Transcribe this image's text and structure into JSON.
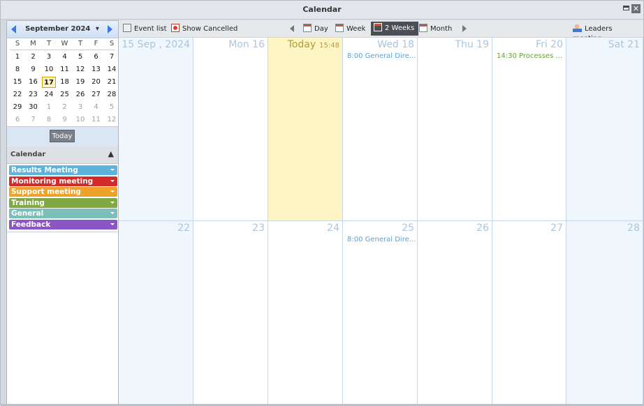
{
  "window": {
    "title": "Calendar",
    "close_glyph": "✕"
  },
  "mini_calendar": {
    "month_label": "September 2024",
    "dropdown_glyph": "▾",
    "weekdays": [
      "S",
      "M",
      "T",
      "W",
      "T",
      "F",
      "S"
    ],
    "weeks": [
      [
        {
          "d": "1"
        },
        {
          "d": "2"
        },
        {
          "d": "3"
        },
        {
          "d": "4"
        },
        {
          "d": "5"
        },
        {
          "d": "6"
        },
        {
          "d": "7"
        }
      ],
      [
        {
          "d": "8"
        },
        {
          "d": "9"
        },
        {
          "d": "10"
        },
        {
          "d": "11"
        },
        {
          "d": "12"
        },
        {
          "d": "13"
        },
        {
          "d": "14"
        }
      ],
      [
        {
          "d": "15"
        },
        {
          "d": "16"
        },
        {
          "d": "17",
          "today": true
        },
        {
          "d": "18"
        },
        {
          "d": "19"
        },
        {
          "d": "20"
        },
        {
          "d": "21"
        }
      ],
      [
        {
          "d": "22"
        },
        {
          "d": "23"
        },
        {
          "d": "24"
        },
        {
          "d": "25"
        },
        {
          "d": "26"
        },
        {
          "d": "27"
        },
        {
          "d": "28"
        }
      ],
      [
        {
          "d": "29"
        },
        {
          "d": "30"
        },
        {
          "d": "1",
          "other": true
        },
        {
          "d": "2",
          "other": true
        },
        {
          "d": "3",
          "other": true
        },
        {
          "d": "4",
          "other": true
        },
        {
          "d": "5",
          "other": true
        }
      ],
      [
        {
          "d": "6",
          "other": true
        },
        {
          "d": "7",
          "other": true
        },
        {
          "d": "8",
          "other": true
        },
        {
          "d": "9",
          "other": true
        },
        {
          "d": "10",
          "other": true
        },
        {
          "d": "11",
          "other": true
        },
        {
          "d": "12",
          "other": true
        }
      ]
    ],
    "today_button": "Today"
  },
  "calendar_panel": {
    "header": "Calendar",
    "collapse_glyph": "⌃",
    "categories": [
      {
        "label": "Results Meeting",
        "color": "#5cb3dc"
      },
      {
        "label": "Monitoring meeting",
        "color": "#d32a2a"
      },
      {
        "label": "Support meeting",
        "color": "#eea22a"
      },
      {
        "label": "Training",
        "color": "#80a843"
      },
      {
        "label": "General",
        "color": "#7ac0b8"
      },
      {
        "label": "Feedback",
        "color": "#8a56c6"
      }
    ]
  },
  "toolbar": {
    "event_list": "Event list",
    "show_cancelled": "Show Cancelled",
    "day": "Day",
    "week": "Week",
    "two_weeks": "2 Weeks",
    "month": "Month",
    "leaders_meeting": "Leaders meeting"
  },
  "grid": {
    "rows": [
      [
        {
          "label": "15 Sep , 2024",
          "type": "weekend"
        },
        {
          "label": "Mon 16"
        },
        {
          "label": "Today",
          "time": "15:48",
          "type": "today"
        },
        {
          "label": "Wed 18",
          "event": {
            "text": "8:00 General Dire...",
            "color": "blue"
          }
        },
        {
          "label": "Thu 19"
        },
        {
          "label": "Fri 20",
          "event": {
            "text": "14:30 Processes ...",
            "color": "green"
          }
        },
        {
          "label": "Sat 21",
          "type": "weekend"
        }
      ],
      [
        {
          "label": "22",
          "type": "weekend"
        },
        {
          "label": "23"
        },
        {
          "label": "24"
        },
        {
          "label": "25",
          "event": {
            "text": "8:00 General Dire...",
            "color": "blue"
          }
        },
        {
          "label": "26"
        },
        {
          "label": "27"
        },
        {
          "label": "28",
          "type": "weekend"
        }
      ]
    ]
  }
}
